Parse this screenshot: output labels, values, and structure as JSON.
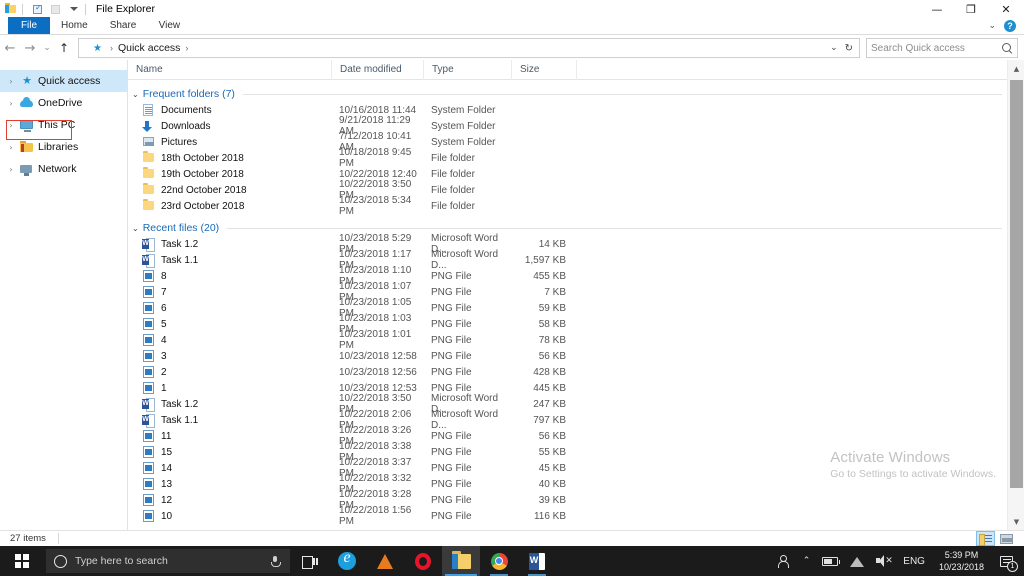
{
  "titlebar": {
    "window_title": "File Explorer",
    "quick_access_icons": [
      "folder-icon",
      "properties-icon",
      "new-folder-icon",
      "customize-caret-icon"
    ],
    "minimize_label": "—",
    "restore_label": "❐",
    "close_label": "✕"
  },
  "ribbon": {
    "tabs": [
      {
        "label": "File",
        "active": false
      },
      {
        "label": "Home",
        "active": false
      },
      {
        "label": "Share",
        "active": false
      },
      {
        "label": "View",
        "active": false
      }
    ],
    "collapse_caret": "⌄",
    "help_label": "?"
  },
  "addressbar": {
    "back_arrow": "←",
    "forward_arrow": "→",
    "recent_caret": "⌄",
    "up_arrow": "↑",
    "breadcrumb_star": "★",
    "breadcrumb_path": "Quick access",
    "breadcrumb_sep": "›",
    "breadcrumb_sep_leading": "›",
    "dropdown_caret": "⌄",
    "refresh_glyph": "↻",
    "search_placeholder": "Search Quick access"
  },
  "sidebar": {
    "items": [
      {
        "label": "Quick access",
        "icon": "star-icon",
        "selected": true
      },
      {
        "label": "OneDrive",
        "icon": "cloud-icon",
        "selected": false
      },
      {
        "label": "This PC",
        "icon": "computer-icon",
        "selected": false,
        "highlighted": true
      },
      {
        "label": "Libraries",
        "icon": "libraries-icon",
        "selected": false
      },
      {
        "label": "Network",
        "icon": "network-icon",
        "selected": false
      }
    ],
    "expand_chevron": "›"
  },
  "columns": {
    "name": "Name",
    "date_modified": "Date modified",
    "type": "Type",
    "size": "Size"
  },
  "groups": [
    {
      "title": "Frequent folders (7)",
      "chevron": "⌄",
      "rows": [
        {
          "name": "Documents",
          "date": "10/16/2018 11:44",
          "type": "System Folder",
          "size": "",
          "icon": "documents-icon"
        },
        {
          "name": "Downloads",
          "date": "9/21/2018 11:29 AM",
          "type": "System Folder",
          "size": "",
          "icon": "downloads-icon"
        },
        {
          "name": "Pictures",
          "date": "7/12/2018 10:41 AM",
          "type": "System Folder",
          "size": "",
          "icon": "pictures-icon"
        },
        {
          "name": "18th October 2018",
          "date": "10/18/2018 9:45 PM",
          "type": "File folder",
          "size": "",
          "icon": "folder-icon"
        },
        {
          "name": "19th October 2018",
          "date": "10/22/2018 12:40",
          "type": "File folder",
          "size": "",
          "icon": "folder-icon"
        },
        {
          "name": "22nd October 2018",
          "date": "10/22/2018 3:50 PM",
          "type": "File folder",
          "size": "",
          "icon": "folder-icon"
        },
        {
          "name": "23rd October 2018",
          "date": "10/23/2018 5:34 PM",
          "type": "File folder",
          "size": "",
          "icon": "folder-icon"
        }
      ]
    },
    {
      "title": "Recent files (20)",
      "chevron": "⌄",
      "rows": [
        {
          "name": "Task 1.2",
          "date": "10/23/2018 5:29 PM",
          "type": "Microsoft Word D...",
          "size": "14 KB",
          "icon": "word-icon"
        },
        {
          "name": "Task 1.1",
          "date": "10/23/2018 1:17 PM",
          "type": "Microsoft Word D...",
          "size": "1,597 KB",
          "icon": "word-icon"
        },
        {
          "name": "8",
          "date": "10/23/2018 1:10 PM",
          "type": "PNG File",
          "size": "455 KB",
          "icon": "png-icon"
        },
        {
          "name": "7",
          "date": "10/23/2018 1:07 PM",
          "type": "PNG File",
          "size": "7 KB",
          "icon": "png-icon"
        },
        {
          "name": "6",
          "date": "10/23/2018 1:05 PM",
          "type": "PNG File",
          "size": "59 KB",
          "icon": "png-icon"
        },
        {
          "name": "5",
          "date": "10/23/2018 1:03 PM",
          "type": "PNG File",
          "size": "58 KB",
          "icon": "png-icon"
        },
        {
          "name": "4",
          "date": "10/23/2018 1:01 PM",
          "type": "PNG File",
          "size": "78 KB",
          "icon": "png-icon"
        },
        {
          "name": "3",
          "date": "10/23/2018 12:58",
          "type": "PNG File",
          "size": "56 KB",
          "icon": "png-icon"
        },
        {
          "name": "2",
          "date": "10/23/2018 12:56",
          "type": "PNG File",
          "size": "428 KB",
          "icon": "png-icon"
        },
        {
          "name": "1",
          "date": "10/23/2018 12:53",
          "type": "PNG File",
          "size": "445 KB",
          "icon": "png-icon"
        },
        {
          "name": "Task 1.2",
          "date": "10/22/2018 3:50 PM",
          "type": "Microsoft Word D...",
          "size": "247 KB",
          "icon": "word-icon"
        },
        {
          "name": "Task 1.1",
          "date": "10/22/2018 2:06 PM",
          "type": "Microsoft Word D...",
          "size": "797 KB",
          "icon": "word-icon"
        },
        {
          "name": "11",
          "date": "10/22/2018 3:26 PM",
          "type": "PNG File",
          "size": "56 KB",
          "icon": "png-icon"
        },
        {
          "name": "15",
          "date": "10/22/2018 3:38 PM",
          "type": "PNG File",
          "size": "55 KB",
          "icon": "png-icon"
        },
        {
          "name": "14",
          "date": "10/22/2018 3:37 PM",
          "type": "PNG File",
          "size": "45 KB",
          "icon": "png-icon"
        },
        {
          "name": "13",
          "date": "10/22/2018 3:32 PM",
          "type": "PNG File",
          "size": "40 KB",
          "icon": "png-icon"
        },
        {
          "name": "12",
          "date": "10/22/2018 3:28 PM",
          "type": "PNG File",
          "size": "39 KB",
          "icon": "png-icon"
        },
        {
          "name": "10",
          "date": "10/22/2018 1:56 PM",
          "type": "PNG File",
          "size": "116 KB",
          "icon": "png-icon"
        }
      ]
    }
  ],
  "scrollbar": {
    "up_arrow": "▲",
    "down_arrow": "▼"
  },
  "watermark": {
    "title": "Activate Windows",
    "subtitle": "Go to Settings to activate Windows."
  },
  "statusbar": {
    "item_count": "27 items",
    "view_details": "details-view-icon",
    "view_large_icons": "large-icons-view-icon"
  },
  "taskbar": {
    "start_label": "windows-logo",
    "search_placeholder": "Type here to search",
    "apps": [
      {
        "name": "task-view",
        "state": "idle"
      },
      {
        "name": "microsoft-edge",
        "state": "idle"
      },
      {
        "name": "vlc",
        "state": "idle"
      },
      {
        "name": "opera",
        "state": "idle"
      },
      {
        "name": "file-explorer",
        "state": "active"
      },
      {
        "name": "google-chrome",
        "state": "open"
      },
      {
        "name": "microsoft-word",
        "state": "open"
      }
    ],
    "tray": {
      "language": "ENG",
      "time": "5:39 PM",
      "date": "10/23/2018",
      "notification_count": "1",
      "speaker_muted": "✕"
    }
  },
  "colors": {
    "accent_blue": "#0b6ec2",
    "selection_blue": "#cfe8f9",
    "group_header_blue": "#1b6ab5",
    "annotation_red": "#e03e2f",
    "taskbar_black": "#1b1b1b",
    "watermark_gray": "#c2c2c2"
  }
}
